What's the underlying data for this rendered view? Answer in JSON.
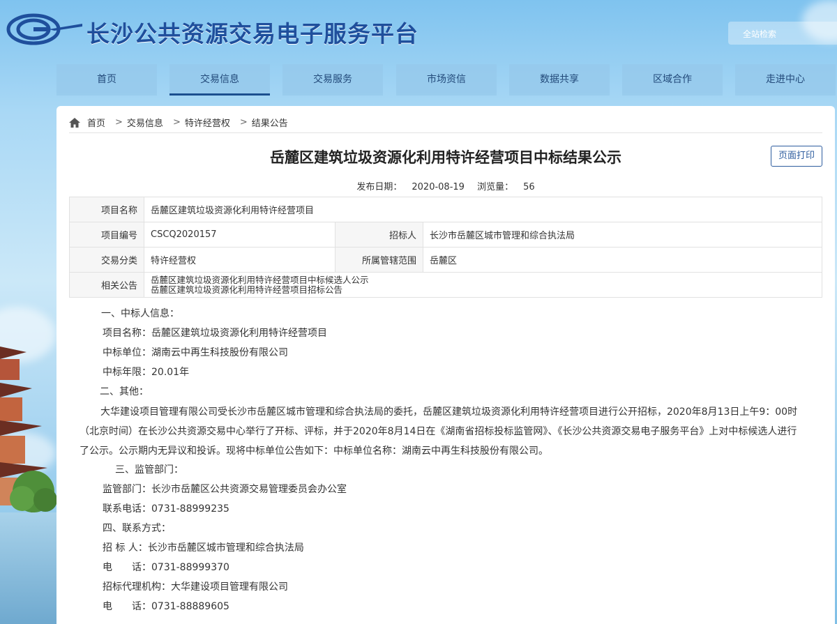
{
  "header": {
    "site_title": "长沙公共资源交易电子服务平台",
    "search_placeholder": "全站检索"
  },
  "nav": {
    "items": [
      {
        "label": "首页"
      },
      {
        "label": "交易信息",
        "active": true
      },
      {
        "label": "交易服务"
      },
      {
        "label": "市场资信"
      },
      {
        "label": "数据共享"
      },
      {
        "label": "区域合作"
      },
      {
        "label": "走进中心"
      }
    ]
  },
  "breadcrumb": {
    "icon": "home-icon",
    "items": [
      "首页",
      "交易信息",
      "特许经营权",
      "结果公告"
    ],
    "separator": ">"
  },
  "article": {
    "title": "岳麓区建筑垃圾资源化利用特许经营项目中标结果公示",
    "print_label": "页面打印",
    "publish_label": "发布日期：",
    "publish_date": "2020-08-19",
    "views_label": "浏览量：",
    "views": "56"
  },
  "info_table": {
    "project_name_label": "项目名称",
    "project_name": "岳麓区建筑垃圾资源化利用特许经营项目",
    "project_no_label": "项目编号",
    "project_no": "CSCQ2020157",
    "tenderer_label": "招标人",
    "tenderer": "长沙市岳麓区城市管理和综合执法局",
    "category_label": "交易分类",
    "category": "特许经营权",
    "scope_label": "所属管辖范围",
    "scope": "岳麓区",
    "related_label": "相关公告",
    "related": [
      "岳麓区建筑垃圾资源化利用特许经营项目中标候选人公示",
      "岳麓区建筑垃圾资源化利用特许经营项目招标公告"
    ]
  },
  "content": {
    "sec1": "一、中标人信息：",
    "project": "项目名称：岳麓区建筑垃圾资源化利用特许经营项目",
    "winner": "中标单位：湖南云中再生科技股份有限公司",
    "term": "中标年限：20.01年",
    "sec2": "二、其他：",
    "paragraph": "大华建设项目管理有限公司受长沙市岳麓区城市管理和综合执法局的委托，岳麓区建筑垃圾资源化利用特许经营项目进行公开招标，2020年8月13日上午9：00时（北京时间）在长沙公共资源交易中心举行了开标、评标，并于2020年8月14日在《湖南省招标投标监管网》、《长沙公共资源交易电子服务平台》上对中标候选人进行了公示。公示期内无异议和投诉。现将中标单位公告如下：中标单位名称：湖南云中再生科技股份有限公司。",
    "sec3": "三、监管部门：",
    "supervisor": "监管部门：长沙市岳麓区公共资源交易管理委员会办公室",
    "supervisor_phone": "联系电话：0731-88999235",
    "sec4": "四、联系方式：",
    "tenderer": "招 标 人：长沙市岳麓区城市管理和综合执法局",
    "tenderer_phone": "电　　话：0731-88999370",
    "agent": "招标代理机构：大华建设项目管理有限公司",
    "agent_phone": "电　　话：0731-88889605"
  },
  "colors": {
    "brand_blue": "#1f4f9c",
    "nav_bg": "#96c8eb",
    "active_underline": "#1b4f8f",
    "print_button": "#2d5c9e"
  }
}
